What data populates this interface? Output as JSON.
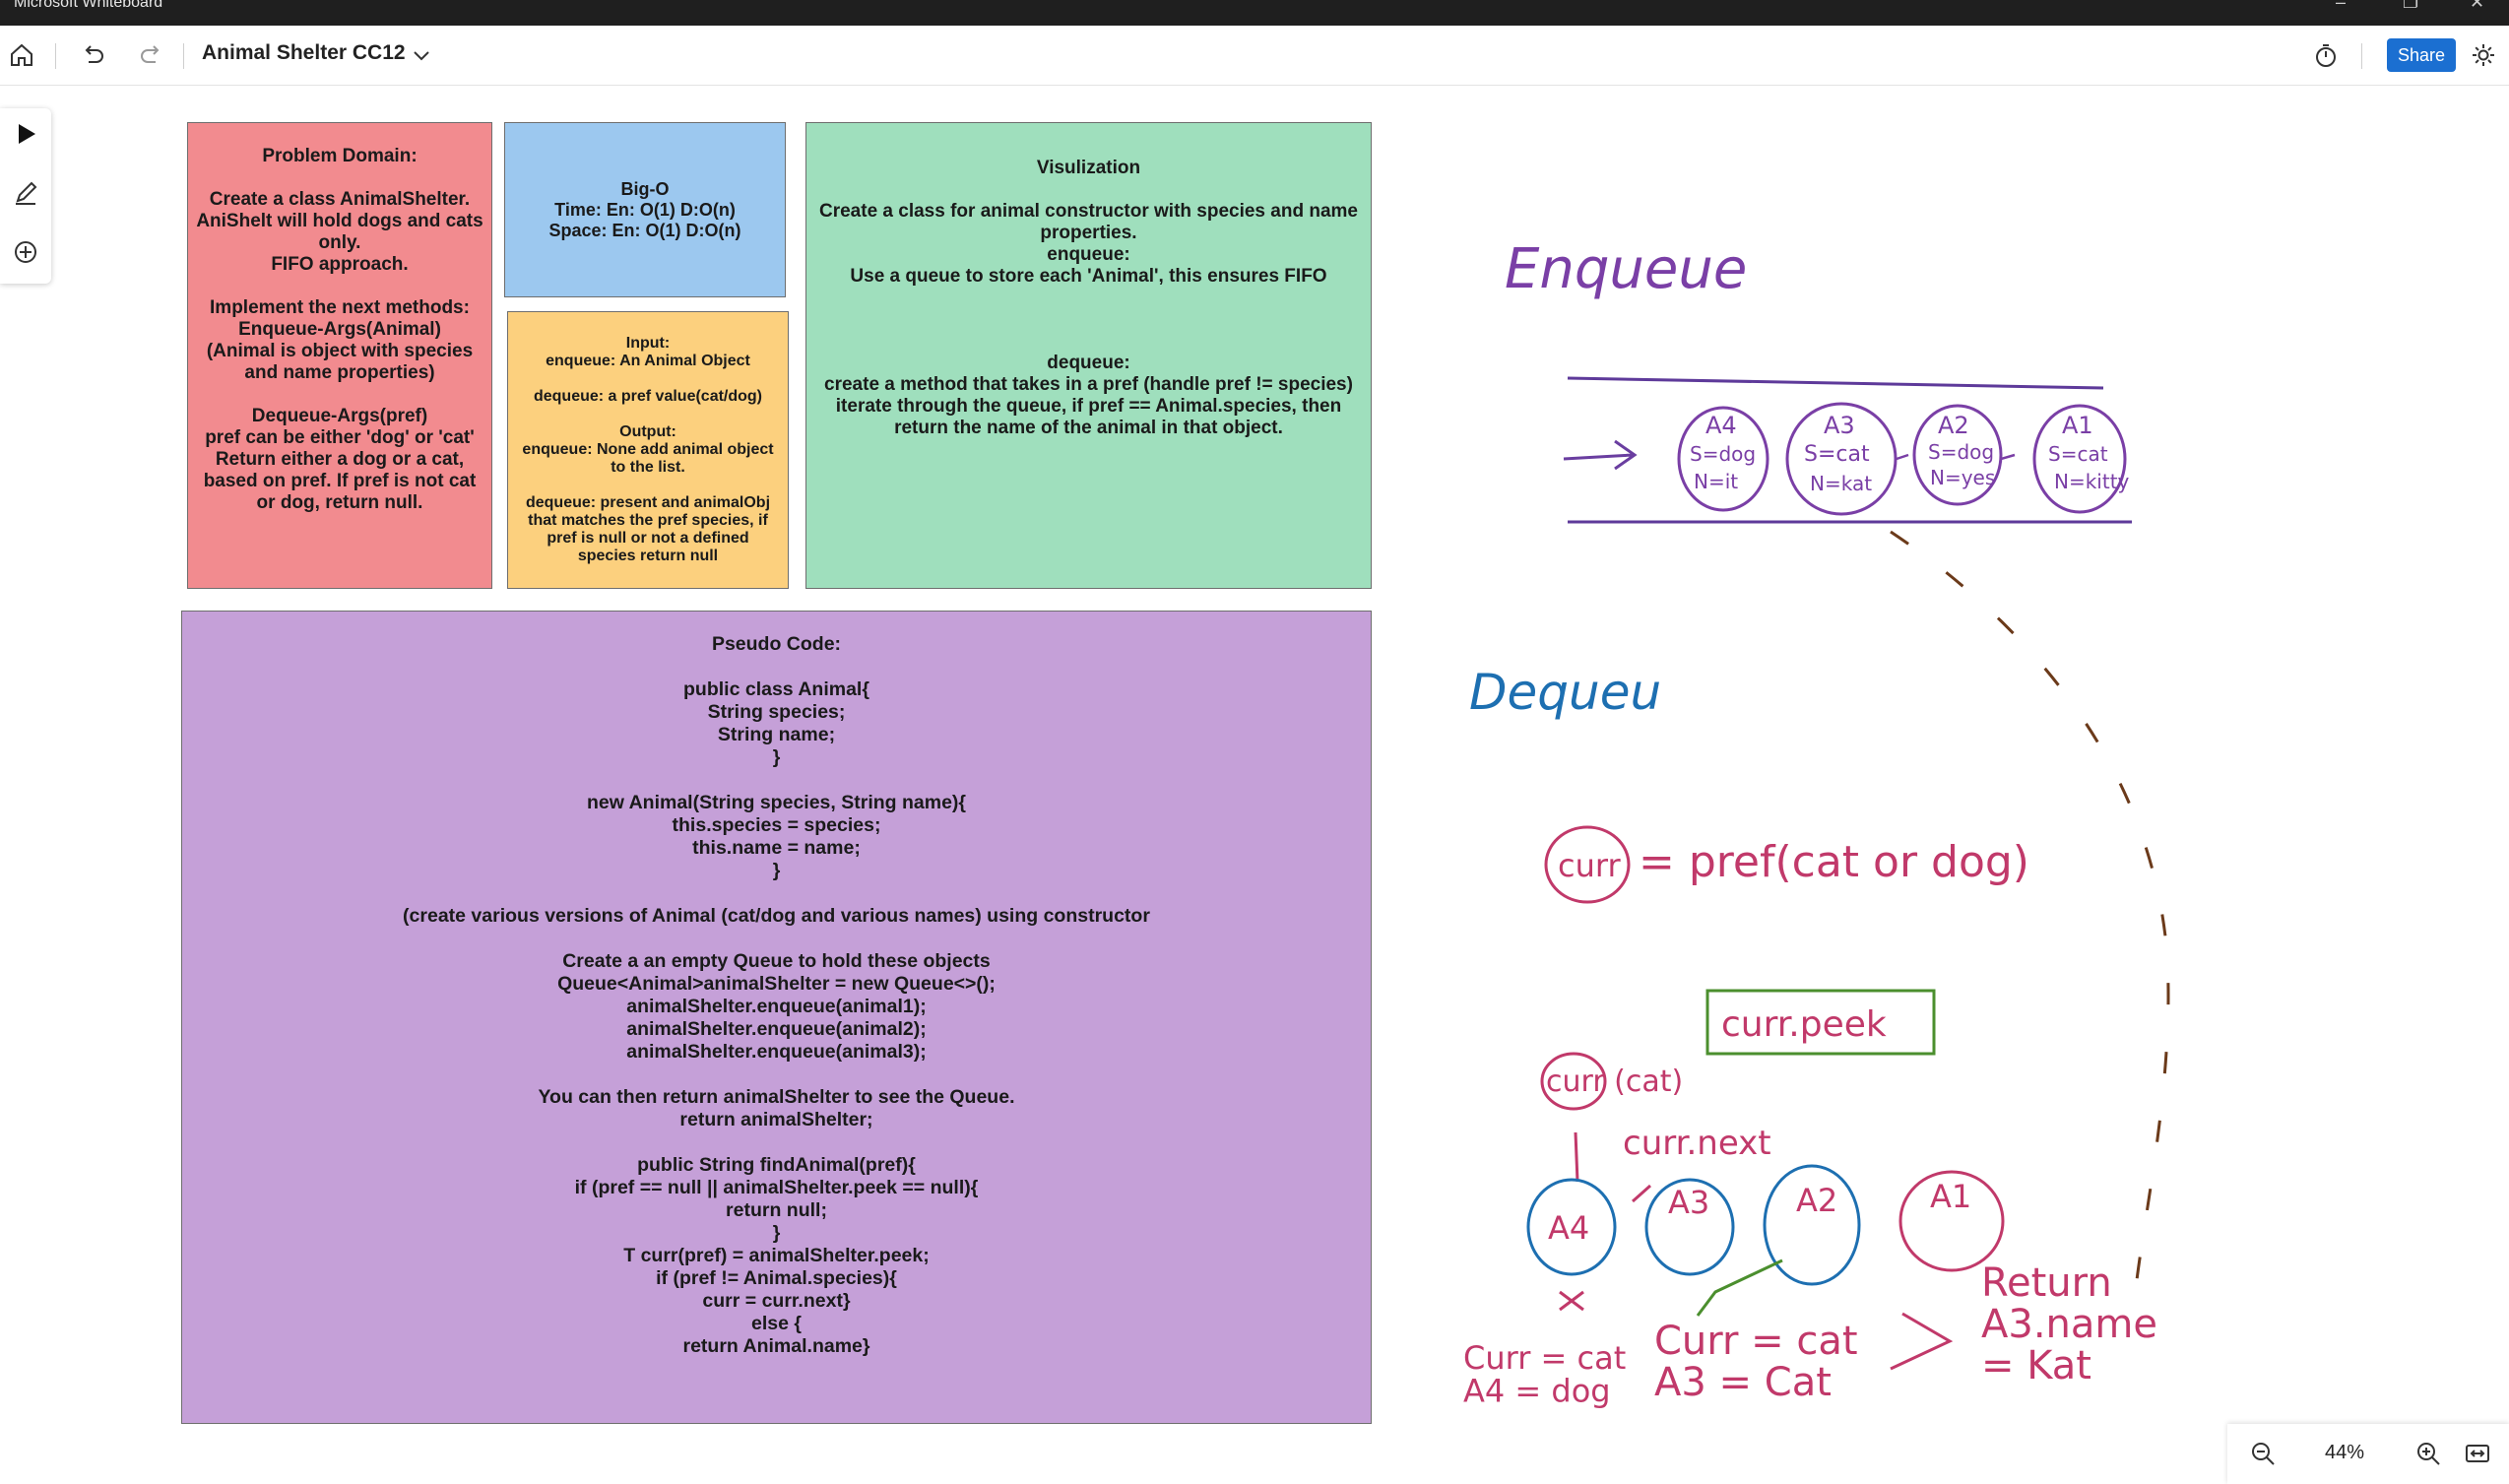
{
  "window": {
    "app_title": "Microsoft Whiteboard",
    "minimize": "–",
    "restore": "❐",
    "close": "✕"
  },
  "toolbar": {
    "board_title": "Animal Shelter CC12",
    "share_label": "Share"
  },
  "notes": {
    "problem_domain": "Problem Domain:\n\nCreate a class AnimalShelter.\nAniShelt will hold dogs and cats only.\nFIFO approach.\n\nImplement the next methods:\nEnqueue-Args(Animal)\n(Animal is object with species and name properties)\n\nDequeue-Args(pref)\npref can be either 'dog' or 'cat'\nReturn either a dog or a cat, based on pref. If pref is not cat or dog, return null.",
    "big_o": "Big-O\nTime: En: O(1) D:O(n)\nSpace: En: O(1) D:O(n)",
    "input_output": "Input:\nenqueue: An Animal Object\n\ndequeue: a pref value(cat/dog)\n\nOutput:\nenqueue: None add animal object to the list.\n\ndequeue: present and animalObj that matches the pref species, if pref is null or not a defined species return null",
    "visualization": "Visulization\n\nCreate a class for animal constructor with species and name properties.\nenqueue:\nUse a queue to store each 'Animal', this ensures FIFO\n\n\n\ndequeue:\ncreate a method that takes in a pref (handle pref != species) iterate through the queue, if pref == Animal.species, then return the name of the animal in that object.",
    "pseudo_code": "Pseudo Code:\n\npublic class Animal{\nString species;\nString name;\n}\n\nnew Animal(String species, String name){\nthis.species = species;\nthis.name = name;\n}\n\n(create various versions of Animal (cat/dog and various names) using constructor\n\nCreate a an empty Queue to hold these objects\nQueue<Animal>animalShelter = new Queue<>();\nanimalShelter.enqueue(animal1);\nanimalShelter.enqueue(animal2);\nanimalShelter.enqueue(animal3);\n\nYou can then return animalShelter to see the Queue.\nreturn animalShelter;\n\npublic String findAnimal(pref){\nif (pref == null || animalShelter.peek == null){\nreturn null;\n}\nT curr(pref) = animalShelter.peek;\nif (pref != Animal.species){\ncurr = curr.next}\nelse {\nreturn Animal.name}"
  },
  "note_colors": {
    "problem_domain": "#f28b8f",
    "big_o": "#9cc8ef",
    "input_output": "#fcd07e",
    "visualization": "#9fdfbd",
    "pseudo_code": "#c5a0d8"
  },
  "ink": {
    "enqueue_heading": "Enqueue",
    "dequeue_heading": "Dequeu",
    "queue_nodes": [
      {
        "id": "A4",
        "species": "S=dog",
        "name": "N=it"
      },
      {
        "id": "A3",
        "species": "S=cat",
        "name": "N=kat"
      },
      {
        "id": "A2",
        "species": "S=dog",
        "name": "N=yes"
      },
      {
        "id": "A1",
        "species": "S=cat",
        "name": "N=kitty"
      }
    ],
    "curr_label": "curr",
    "pref_text": "= pref(cat or dog)",
    "curr_cat": "curr (cat)",
    "curr_peek": "curr.peek",
    "curr_next": "curr.next",
    "dequeue_nodes": [
      "A4",
      "A3",
      "A2",
      "A1"
    ],
    "note_left": "Curr = cat\nA4 = dog",
    "note_mid": "Curr = cat\nA3 = Cat",
    "return_note": "Return\nA3.name\n= Kat"
  },
  "zoom": {
    "level": "44%"
  },
  "icons": [
    "home-icon",
    "undo-icon",
    "redo-icon",
    "chevron-down-icon",
    "timer-icon",
    "settings-icon",
    "select-icon",
    "pen-icon",
    "add-icon",
    "zoom-out-icon",
    "zoom-in-icon",
    "fit-screen-icon"
  ]
}
